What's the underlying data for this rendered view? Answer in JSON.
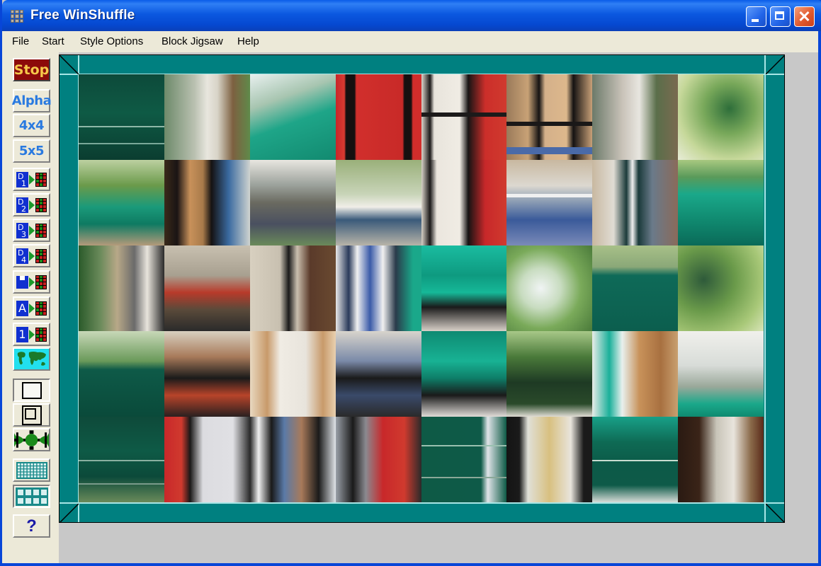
{
  "window": {
    "title": "Free WinShuffle",
    "controls": {
      "minimize": "minimize",
      "maximize": "maximize",
      "close": "✕"
    }
  },
  "menu": {
    "items": [
      "File",
      "Start",
      "Style Options",
      "Block Jigsaw",
      "Help"
    ]
  },
  "toolbar": {
    "stop_label": "Stop",
    "alpha_label": "Alpha",
    "grid4_label": "4x4",
    "grid5_label": "5x5",
    "load_buttons": [
      {
        "kind": "D",
        "num": "1"
      },
      {
        "kind": "D",
        "num": "2"
      },
      {
        "kind": "D",
        "num": "3"
      },
      {
        "kind": "D",
        "num": "4"
      },
      {
        "kind": "disk",
        "num": ""
      },
      {
        "kind": "A",
        "num": ""
      },
      {
        "kind": "1",
        "num": ""
      }
    ],
    "icons": [
      "world-map",
      "plain-border",
      "double-border",
      "jigsaw-edge",
      "fine-grid",
      "coarse-grid"
    ],
    "help_label": "?"
  },
  "board": {
    "columns": 8,
    "rows": 5,
    "frame_color": "#008080",
    "frame_highlight": "#a8e6e6",
    "tiles": [
      {
        "desc": "green awning",
        "bg": "linear-gradient(180deg,#0d4a3a 0%,#0e5a45 45%,#0b3d30 100%)",
        "stripes": [
          {
            "t": 60,
            "h": 2,
            "c": "#8fb8a8"
          },
          {
            "t": 80,
            "h": 2,
            "c": "#7aa898"
          }
        ]
      },
      {
        "desc": "tree trunk market",
        "bg": "linear-gradient(90deg,#6d8a6a 0%,#b9c0b0 35%,#e8e6de 50%,#d8d4c8 62%,#7d6040 80%,#5f8a4a 100%)",
        "stripes": []
      },
      {
        "desc": "teal awning foliage",
        "bg": "linear-gradient(160deg,#e8f0ef 0%,#a7c5b0 30%,#1ea588 55%,#128a70 100%)",
        "stripes": []
      },
      {
        "desc": "red sun banner",
        "bg": "linear-gradient(90deg,#c8262a 0%,#d73a30 10%,#151010 12%,#151010 22%,#d12f2c 24%,#c82a28 78%,#161010 80%,#161010 88%,#d02d2b 90%)",
        "stripes": []
      },
      {
        "desc": "fence and trunk",
        "bg": "linear-gradient(90deg,#dcd6cc 0%,#1a1818 10%,#e8e4dc 15%,#f0ece4 45%,#161414 55%,#cc2e2a 75%,#d03a2e 100%)",
        "stripes": [
          {
            "t": 45,
            "h": 6,
            "c": "#1c1a1a"
          }
        ]
      },
      {
        "desc": "fence wooden post",
        "bg": "linear-gradient(90deg,#9a7a5a 0%,#c8a276 25%,#141212 38%,#d4b08a 45%,#ddb88c 70%,#151212 78%,#c8a078 100%)",
        "stripes": [
          {
            "t": 55,
            "h": 6,
            "c": "#1a1818"
          },
          {
            "t": 85,
            "h": 10,
            "c": "#4a6aa8"
          }
        ]
      },
      {
        "desc": "market crowd",
        "bg": "linear-gradient(90deg,#6c7a6a 0%,#c8c2b8 35%,#e8e6e0 55%,#5a6e4a 75%,#7a6a50 100%)",
        "stripes": []
      },
      {
        "desc": "leaves",
        "bg": "radial-gradient(circle at 60% 40%,#2e6e3a 0%,#78a85a 35%,#c6d89a 70%,#e8ecd8 100%)",
        "stripes": []
      },
      {
        "desc": "foliage teal awning",
        "bg": "linear-gradient(180deg,#bcd0a0 0%,#6a9a4a 30%,#1a9a7a 55%,#0e7a62 75%,#b49a7a 100%)",
        "stripes": []
      },
      {
        "desc": "wood frame booth",
        "bg": "linear-gradient(90deg,#3a2a1a 0%,#1a1414 15%,#c8915a 30%,#a87a4a 45%,#151212 55%,#3a6aa0 75%,#d0d4d0 100%)",
        "stripes": []
      },
      {
        "desc": "monument person",
        "bg": "linear-gradient(180deg,#e8e6e0 0%,#9aa09a 30%,#6a6a60 50%,#4a5060 75%,#6a8a5a 100%)",
        "stripes": []
      },
      {
        "desc": "park crowd",
        "bg": "linear-gradient(180deg,#9ab07a 0%,#c8d4b8 40%,#f0eee8 55%,#3a5a7a 70%,#b8b4a8 100%)",
        "stripes": []
      },
      {
        "desc": "trunk red banner",
        "bg": "linear-gradient(90deg,#d8d2c8 0%,#1a1818 10%,#ebe6de 18%,#f0ece4 45%,#151313 55%,#c8282a 75%,#d03a2e 100%)",
        "stripes": []
      },
      {
        "desc": "fence blue",
        "bg": "linear-gradient(180deg,#c8b8a0 0%,#dcd8d0 30%,#9aa8b8 45%,#3a5a9a 70%,#7a8ab8 100%)",
        "stripes": [
          {
            "t": 40,
            "h": 5,
            "c": "#f0f0f0"
          }
        ]
      },
      {
        "desc": "striped tent",
        "bg": "linear-gradient(90deg,#c8b8a0 0%,#e0dcd4 25%,#1a3a3a 40%,#f0f0f0 47%,#1a3a3a 54%,#6a7a8a 70%,#8a6a5a 100%)",
        "stripes": []
      },
      {
        "desc": "teal awning foliage",
        "bg": "linear-gradient(180deg,#a8c880 0%,#5a9a5a 20%,#1aa88a 40%,#108a70 70%,#0a6a58 100%)",
        "stripes": []
      },
      {
        "desc": "art booth people",
        "bg": "linear-gradient(90deg,#2a5a2a 0%,#6a8a5a 25%,#b8a888 45%,#6a6a6a 65%,#e8e4dc 80%,#2a2a2a 100%)",
        "stripes": []
      },
      {
        "desc": "vendor table",
        "bg": "linear-gradient(180deg,#c8c0b0 0%,#a8a090 35%,#b83a2a 55%,#5a4a3a 75%,#2a2a2a 100%)",
        "stripes": []
      },
      {
        "desc": "fence hair",
        "bg": "linear-gradient(90deg,#d8d0c0 0%,#c8c0b0 35%,#1a1a1a 45%,#cabfae 55%,#5a3a2a 70%,#6a4a30 100%)",
        "stripes": []
      },
      {
        "desc": "bars blue",
        "bg": "linear-gradient(90deg,#e8e8e8 0%,#2a3a5a 15%,#f0f0f0 25%,#3a5aa8 40%,#f0f0f0 55%,#2a3a4a 70%,#1aa88a 90%)",
        "stripes": []
      },
      {
        "desc": "bright teal awning",
        "bg": "linear-gradient(180deg,#1abca0 0%,#0e9a80 35%,#16b898 55%,#1a1a1a 72%,#d8d0c8 100%)",
        "stripes": []
      },
      {
        "desc": "sky leaves",
        "bg": "radial-gradient(circle at 40% 50%,#f0f4f4 0%,#c8dcc0 30%,#7aaa5a 60%,#4a7a3a 100%)",
        "stripes": []
      },
      {
        "desc": "green awning leaves",
        "bg": "linear-gradient(180deg,#a8c088 0%,#8aa878 25%,#0e6a58 35%,#0c5e4e 100%)",
        "stripes": []
      },
      {
        "desc": "leaves dark",
        "bg": "radial-gradient(circle at 30% 40%,#2e5a3a 0%,#6a9a4a 40%,#a8c878 75%,#d8e4b8 100%)",
        "stripes": []
      },
      {
        "desc": "foliage green awning",
        "bg": "linear-gradient(180deg,#c8d8b8 0%,#6a9a5a 35%,#0e5a48 45%,#0a4a3a 100%)",
        "stripes": []
      },
      {
        "desc": "fence pots",
        "bg": "linear-gradient(180deg,#d8d0c0 0%,#a87a5a 30%,#1a1a1a 55%,#b8442a 75%,#2a2020 100%)",
        "stripes": []
      },
      {
        "desc": "wooden door",
        "bg": "linear-gradient(90deg,#e8d8c0 0%,#c89a6a 20%,#f0ece4 35%,#e8e4dc 65%,#c89a6a 85%,#e8d0b0 100%)",
        "stripes": []
      },
      {
        "desc": "fence blue table",
        "bg": "linear-gradient(180deg,#d8d4cc 0%,#7a8aa8 35%,#1a1a1a 55%,#3a4a6a 75%,#2a2a2a 100%)",
        "stripes": []
      },
      {
        "desc": "teal awning bars",
        "bg": "linear-gradient(180deg,#0e8a72 0%,#18b294 35%,#0e7e68 55%,#1a1a1a 75%,#e0dcd8 100%)",
        "stripes": []
      },
      {
        "desc": "dark foliage",
        "bg": "linear-gradient(180deg,#a8c888 0%,#4a7a3a 30%,#1e3a24 60%,#2a4a2a 85%,#e0dcd4 100%)",
        "stripes": []
      },
      {
        "desc": "teal tent post",
        "bg": "linear-gradient(90deg,#e8ece8 0%,#1ab09a 20%,#e8f0ee 35%,#c8925a 55%,#a87040 80%,#c8a070 100%)",
        "stripes": []
      },
      {
        "desc": "birch teal awning",
        "bg": "linear-gradient(180deg,#f0f0ec 0%,#d8dcd8 40%,#9aa89a 65%,#1aa88a 85%,#0e8a70 100%)",
        "stripes": []
      },
      {
        "desc": "dark green awning",
        "bg": "linear-gradient(180deg,#0e4a3a 0%,#0e5a46 40%,#0c4a3a 70%,#6a8a5a 100%)",
        "stripes": [
          {
            "t": 50,
            "h": 2,
            "c": "#8ab0a0"
          },
          {
            "t": 78,
            "h": 2,
            "c": "#7a9a8a"
          }
        ]
      },
      {
        "desc": "red banner fence",
        "bg": "linear-gradient(90deg,#c8282a 0%,#d03a2e 20%,#1a1818 30%,#dcdce0 45%,#e0e0e4 80%,#2a2a2a 100%)",
        "stripes": []
      },
      {
        "desc": "fence people",
        "bg": "linear-gradient(90deg,#2a2a2a 0%,#f0f0f0 10%,#1a1a1a 25%,#5a7aa8 40%,#a87a5a 60%,#1a1a1a 80%,#e0e4e8 100%)",
        "stripes": []
      },
      {
        "desc": "fence red banner",
        "bg": "linear-gradient(90deg,#9aa0a8 0%,#1a1a1a 20%,#8a8a90 35%,#c8282a 55%,#d03a2e 80%,#2a2a2a 100%)",
        "stripes": []
      },
      {
        "desc": "green awning white",
        "bg": "linear-gradient(90deg,#0e5a46 0%,#0e5a48 70%,#e0e4e8 78%,#0e5a46 100%)",
        "stripes": [
          {
            "t": 33,
            "h": 2,
            "c": "#9ac0b0"
          },
          {
            "t": 70,
            "h": 2,
            "c": "#8aa898"
          }
        ]
      },
      {
        "desc": "booth window",
        "bg": "linear-gradient(90deg,#141414 0%,#1a1a1a 15%,#e0e0d8 25%,#d8c080 50%,#e8e4dc 75%,#1a1a1a 90%)",
        "stripes": []
      },
      {
        "desc": "green awning rope",
        "bg": "linear-gradient(180deg,#18a088 0%,#0e6a54 30%,#0c5a48 55%,#0e5a48 80%,#d8dcd8 100%)",
        "stripes": [
          {
            "t": 50,
            "h": 2,
            "c": "#c8dcd0"
          }
        ]
      },
      {
        "desc": "hair birch",
        "bg": "linear-gradient(90deg,#2a1a12 0%,#3a2418 25%,#c8c4b8 45%,#e8e4dc 65%,#8a6a4a 85%,#5a2a1a 100%)",
        "stripes": []
      }
    ]
  }
}
